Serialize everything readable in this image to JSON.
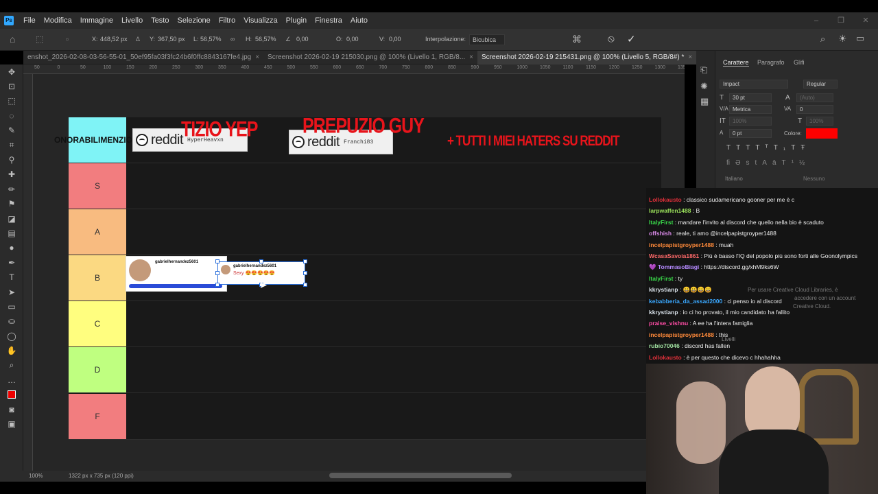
{
  "app": {
    "logo": "Ps",
    "menu": [
      "File",
      "Modifica",
      "Immagine",
      "Livello",
      "Testo",
      "Selezione",
      "Filtro",
      "Visualizza",
      "Plugin",
      "Finestra",
      "Aiuto"
    ],
    "window_controls": [
      "–",
      "❐",
      "✕"
    ]
  },
  "options_bar": {
    "x_label": "X:",
    "x_value": "448,52 px",
    "y_label": "Y:",
    "y_value": "367,50 px",
    "w_label": "L:",
    "w_value": "56,57%",
    "h_label": "H:",
    "h_value": "56,57%",
    "angle_value": "0,00",
    "h_skew_label": "O:",
    "h_skew_value": "0,00",
    "v_skew_label": "V:",
    "v_skew_value": "0,00",
    "interp_label": "Interpolazione:",
    "interp_value": "Bicubica",
    "cancel_icon": "cancel-icon",
    "commit_icon": "commit-checkmark-icon"
  },
  "tabs": [
    {
      "label": "enshot_2026-02-08-03-56-55-01_50ef95fa03f3fc24b6f0ffc8843167fe4.jpg",
      "active": false
    },
    {
      "label": "Screenshot 2026-02-19 215030.png @ 100% (Livello 1, RGB/8...",
      "active": false
    },
    {
      "label": "Screenshot 2026-02-19 215431.png @ 100% (Livello 5, RGB/8#) *",
      "active": true
    }
  ],
  "ruler_numbers": [
    "50",
    "0",
    "50",
    "100",
    "150",
    "200",
    "250",
    "300",
    "350",
    "400",
    "450",
    "500",
    "550",
    "600",
    "650",
    "700",
    "750",
    "800",
    "850",
    "900",
    "950",
    "1000",
    "1050",
    "1100",
    "1150",
    "1200",
    "1250",
    "1300",
    "1350"
  ],
  "tierlist": {
    "header_label": "ONORABILI\nMENZIONI",
    "header_color": "#7ff3f6",
    "tiers": [
      {
        "label": "S",
        "color": "#f27d7f"
      },
      {
        "label": "A",
        "color": "#f8bb80"
      },
      {
        "label": "B",
        "color": "#fbd982"
      },
      {
        "label": "C",
        "color": "#fffe7f"
      },
      {
        "label": "D",
        "color": "#bfff80"
      },
      {
        "label": "F",
        "color": "#f27d7f"
      }
    ],
    "mentions": [
      {
        "title": "TIZIO YEP",
        "badge_word": "reddit",
        "badge_user": "HyperHeavxn"
      },
      {
        "title": "PREPUZIO GUY",
        "badge_word": "reddit",
        "badge_user": "Franchi83"
      }
    ],
    "haters_text": "+ TUTTI I MIEI HATERS SU REDDIT",
    "b_item": {
      "name1": "gabrielhernandez5601",
      "name2": "gabrielhernandez5601",
      "sub": "Sexy 😍😍😍😍😍"
    }
  },
  "right_panel": {
    "tabs": [
      "Carattere",
      "Paragrafo",
      "Glifi"
    ],
    "font_family": "Impact",
    "font_style": "Regular",
    "font_size": "30 pt",
    "leading": "(Auto)",
    "kerning": "Metrica",
    "tracking": "0",
    "vscale": "100%",
    "hscale": "100%",
    "baseline": "0 pt",
    "color_label": "Colore:",
    "color": "#ff0000",
    "language": "Italiano",
    "aa": "Nessuno",
    "subtabs": [
      "Proprietà",
      "Librerie",
      "Composizioni livelli"
    ]
  },
  "chat": [
    {
      "user": "Lollokausto",
      "color": "#e0303a",
      "msg": ": classico sudamericano gooner per me è c"
    },
    {
      "user": "larpwaffen1488",
      "color": "#9ae05a",
      "msg": ": B"
    },
    {
      "user": "ItalyFirst",
      "color": "#39d94a",
      "msg": ": mandare l'invito al discord che quello nella bio è scaduto"
    },
    {
      "user": "offshish",
      "color": "#d98ae8",
      "msg": ": reale, ti amo @incelpapistgroyper1488"
    },
    {
      "user": "incelpapistgroyper1488",
      "color": "#ff8a3a",
      "msg": ": muah"
    },
    {
      "user": "WcasaSavoia1861",
      "color": "#ff6a6a",
      "msg": ": Più è basso l'IQ del popolo più sono forti alle Goonolympics"
    },
    {
      "user": "💜 TommasoBiagi",
      "color": "#b58aff",
      "msg": ": https://discord.gg/xhM9ks6W"
    },
    {
      "user": "ItalyFirst",
      "color": "#39d94a",
      "msg": ": ty"
    },
    {
      "user": "kkrystianp",
      "color": "#d8e0e8",
      "msg": ": 😀😀😀😀"
    },
    {
      "user": "kebabberia_da_assad2000",
      "color": "#3aa8ff",
      "msg": ": ci penso io al discord"
    },
    {
      "user": "kkrystianp",
      "color": "#d8e0e8",
      "msg": ": io ci ho provato, il mio candidato ha fallito"
    },
    {
      "user": "praise_vishnu",
      "color": "#ff4da6",
      "msg": ": A ee ha l'intera famiglia"
    },
    {
      "user": "incelpapistgroyper1488",
      "color": "#ff8a3a",
      "msg": ": this"
    },
    {
      "user": "rubio70046",
      "color": "#a0e0a0",
      "msg": ": discord has fallen"
    },
    {
      "user": "Lollokausto",
      "color": "#e0303a",
      "msg": ": è per questo che dicevo c hhahahha"
    }
  ],
  "ghost_text": {
    "cc": "Per usare Creative Cloud Libraries, è",
    "cc2": "accedere con un account",
    "cc3": "Creative Cloud.",
    "livelli": "Livelli"
  },
  "status": {
    "zoom": "100%",
    "doc": "1322 px x 735 px (120 ppi)"
  }
}
